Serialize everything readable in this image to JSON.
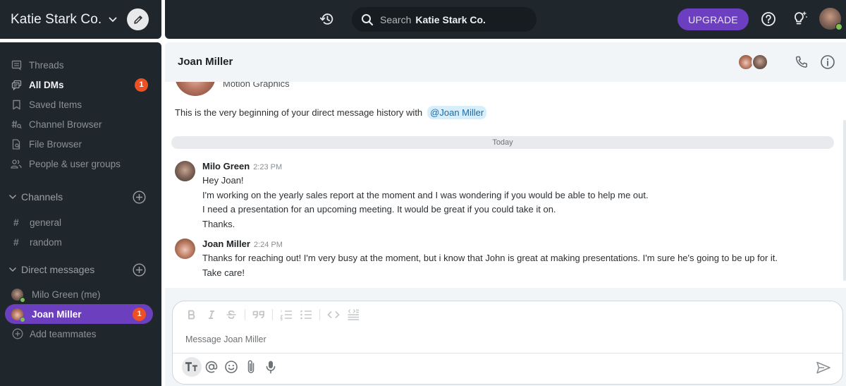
{
  "workspace": {
    "name": "Katie Stark Co."
  },
  "topbar": {
    "search_label": "Search",
    "search_scope": "Katie Stark Co.",
    "upgrade_label": "UPGRADE"
  },
  "sidebar": {
    "nav": [
      {
        "label": "Threads",
        "icon": "threads-icon"
      },
      {
        "label": "All DMs",
        "icon": "dms-icon",
        "badge": "1",
        "bold": true
      },
      {
        "label": "Saved Items",
        "icon": "bookmark-icon"
      },
      {
        "label": "Channel Browser",
        "icon": "channel-browser-icon"
      },
      {
        "label": "File Browser",
        "icon": "file-browser-icon"
      },
      {
        "label": "People & user groups",
        "icon": "people-icon"
      }
    ],
    "channels_header": "Channels",
    "channels": [
      {
        "label": "general"
      },
      {
        "label": "random"
      }
    ],
    "dms_header": "Direct messages",
    "dms": [
      {
        "label": "Milo Green (me)",
        "online": true
      },
      {
        "label": "Joan Miller",
        "online": true,
        "active": true,
        "badge": "1"
      }
    ],
    "add_teammates": "Add teammates"
  },
  "chat": {
    "title": "Joan Miller",
    "intro_role": "Motion Graphics",
    "intro_text": "This is the very beginning of your direct message history with",
    "intro_mention": "@Joan Miller",
    "day_divider": "Today",
    "messages": [
      {
        "author": "Milo Green",
        "time": "2:23 PM",
        "lines": [
          "Hey Joan!",
          "I'm working on the yearly sales report at the moment and I was wondering if you would be able to help me out.",
          "I need a presentation for an upcoming meeting. It would be great if you could take it on.",
          "Thanks."
        ]
      },
      {
        "author": "Joan Miller",
        "time": "2:24 PM",
        "lines": [
          "Thanks for reaching out! I'm very busy at the moment, but i know that John is great at making presentations. I'm sure he's going to be up for it.",
          "Take care!"
        ]
      }
    ]
  },
  "composer": {
    "placeholder": "Message Joan Miller",
    "value": ""
  },
  "colors": {
    "sidebar_bg": "#1f262c",
    "accent": "#6b3fbe",
    "badge": "#ec5126",
    "online": "#7dc34f",
    "mention_bg": "#d7eefc"
  }
}
